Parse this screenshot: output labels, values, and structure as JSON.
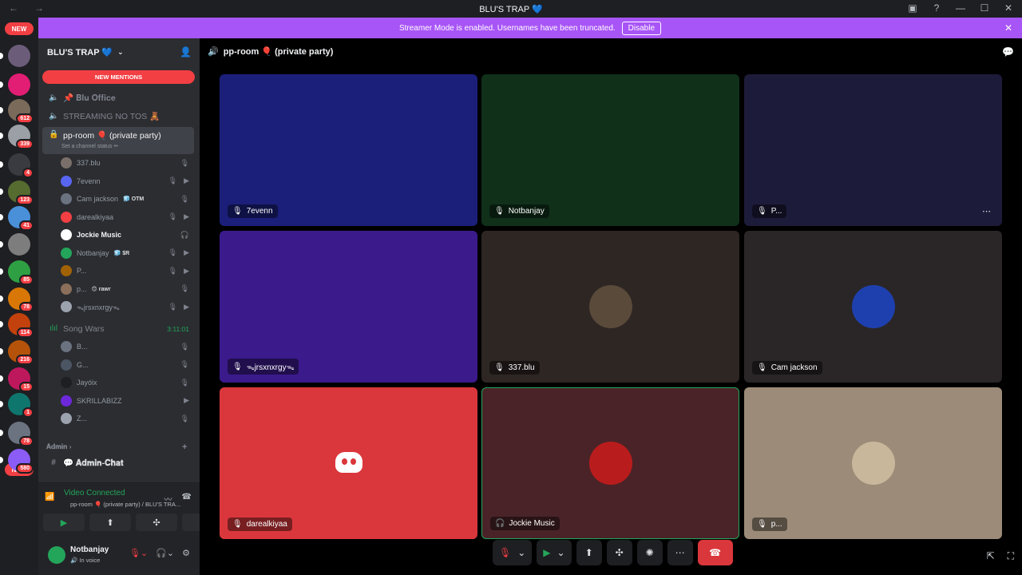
{
  "window": {
    "title": "BLU'S TRAP 💙"
  },
  "banner": {
    "text": "Streamer Mode is enabled. Usernames have been truncated.",
    "disable": "Disable"
  },
  "guilds": [
    {
      "badge": "",
      "color": "#6b5d7a"
    },
    {
      "badge": "",
      "color": "#e11d74"
    },
    {
      "badge": "612",
      "color": "#7a6a5a"
    },
    {
      "badge": "339",
      "color": "#9aa0a6"
    },
    {
      "badge": "4",
      "color": "#3a3b40"
    },
    {
      "badge": "123",
      "color": "#556b2f"
    },
    {
      "badge": "41",
      "color": "#4a90d9"
    },
    {
      "badge": "",
      "color": "#7d7d7d"
    },
    {
      "badge": "85",
      "color": "#2ea043"
    },
    {
      "badge": "78",
      "color": "#d97706"
    },
    {
      "badge": "114",
      "color": "#c2410c"
    },
    {
      "badge": "216",
      "color": "#b45309"
    },
    {
      "badge": "15",
      "color": "#be185d"
    },
    {
      "badge": "1",
      "color": "#0f766e"
    },
    {
      "badge": "78",
      "color": "#6b7280"
    },
    {
      "badge": "580",
      "color": "#8b5cf6"
    }
  ],
  "newpill": "NEW",
  "server": {
    "name": "BLU'S TRAP 💙",
    "new_mentions": "NEW MENTIONS"
  },
  "channels": {
    "c1": "📌 𝐁𝐥𝐮 𝐎𝐟𝐟𝐢𝐜𝐞",
    "c2": "STREAMING NO TOS 🧸",
    "active": "pp-room 🎈 (private party)",
    "active_status": "Set a channel status ✏",
    "songwars": "Song Wars",
    "songwars_timer": "3:11:01",
    "admin_cat": "𝐀𝐝𝐦𝐢𝐧",
    "admin_chat": "💬 𝐀𝐝𝐦𝐢𝐧-𝐂𝐡𝐚𝐭"
  },
  "members": [
    {
      "name": "337.blu",
      "tag": ""
    },
    {
      "name": "7evenn",
      "tag": ""
    },
    {
      "name": "Cam jackson",
      "tag": "🧊 OTM"
    },
    {
      "name": "darealkiyaa",
      "tag": ""
    },
    {
      "name": "Jockie Music",
      "tag": ""
    },
    {
      "name": "Notbanjay",
      "tag": "🧊 $R"
    },
    {
      "name": "P...",
      "tag": ""
    },
    {
      "name": "p...",
      "tag": "😊 rawr"
    },
    {
      "name": "ᯓjrsxnxrgyᯓ",
      "tag": ""
    }
  ],
  "songwars_members": [
    "B...",
    "G...",
    "Jayóix",
    "SKRILLABIZZ",
    "Z..."
  ],
  "voice": {
    "status": "Video Connected",
    "sub": "pp-room 🎈 (private party) / BLU'S TRA..."
  },
  "user": {
    "name": "Notbanjay",
    "status": "🔊 In voice"
  },
  "stage": {
    "channel": "pp-room 🎈 (private party)"
  },
  "tiles": [
    {
      "label": "7evenn",
      "bg": "#1b1f7a"
    },
    {
      "label": "Notbanjay",
      "bg": "#10301a"
    },
    {
      "label": "P...",
      "bg": "#1d1b3a"
    },
    {
      "label": "ᯓjrsxnxrgyᯓ",
      "bg": "#3b1a8c"
    },
    {
      "label": "337.blu",
      "bg": "#2e2623"
    },
    {
      "label": "Cam jackson",
      "bg": "#2a2627"
    },
    {
      "label": "darealkiyaa",
      "bg": "#da373c"
    },
    {
      "label": "Jockie Music",
      "bg": "#4a2328"
    },
    {
      "label": "p...",
      "bg": "#9c8b78"
    }
  ]
}
